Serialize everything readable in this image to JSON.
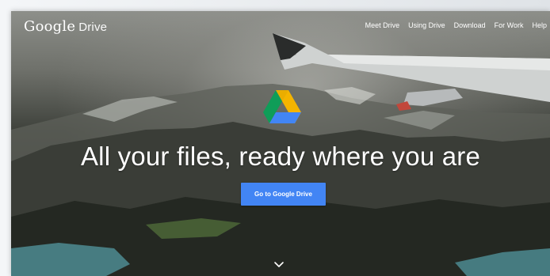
{
  "header": {
    "brand_google": "Google",
    "brand_drive": "Drive",
    "nav": [
      "Meet Drive",
      "Using Drive",
      "Download",
      "For Work",
      "Help"
    ]
  },
  "hero": {
    "headline": "All your files, ready where you are",
    "cta_label": "Go to Google Drive",
    "scroll_icon": "chevron-down-icon",
    "logo_icon": "google-drive-logo"
  },
  "colors": {
    "cta": "#4285f4",
    "drive_green": "#0f9d58",
    "drive_yellow": "#f4b400",
    "drive_blue": "#4285f4"
  }
}
